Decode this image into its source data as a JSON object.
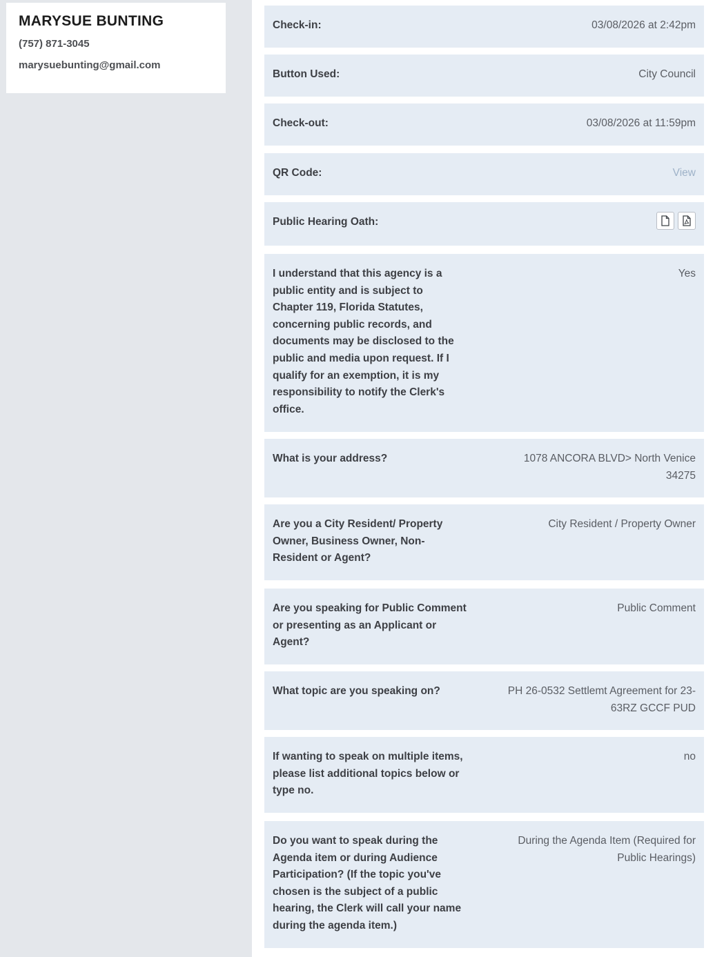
{
  "contact": {
    "name": "MARYSUE BUNTING",
    "phone": "(757) 871-3045",
    "email": "marysuebunting@gmail.com"
  },
  "rows": [
    {
      "label": "Check-in:",
      "value": "03/08/2026 at 2:42pm"
    },
    {
      "label": "Button Used:",
      "value": "City Council"
    },
    {
      "label": "Check-out:",
      "value": "03/08/2026 at 11:59pm"
    },
    {
      "label": "QR Code:",
      "value": "View"
    },
    {
      "label": "Public Hearing Oath:",
      "icons": [
        "document-icon",
        "pdf-icon"
      ]
    },
    {
      "label": "I understand that this agency is a public entity and is subject to Chapter 119, Florida Statutes, concerning public records, and documents may be disclosed to the public and media upon request. If I qualify for an exemption, it is my responsibility to notify the Clerk's office.",
      "value": "Yes"
    },
    {
      "label": "What is your address?",
      "value": "1078 ANCORA BLVD> North Venice 34275"
    },
    {
      "label": "Are you a City Resident/ Property Owner, Business Owner, Non-Resident or Agent?",
      "value": "City Resident / Property Owner"
    },
    {
      "label": "Are you speaking for Public Comment or presenting as an Applicant or Agent?",
      "value": "Public Comment"
    },
    {
      "label": "What topic are you speaking on?",
      "value": "PH 26-0532 Settlemt Agreement for 23-63RZ GCCF PUD"
    },
    {
      "label": "If wanting to speak on multiple items, please list additional topics below or type no.",
      "value": "no"
    },
    {
      "label": "Do you want to speak during the Agenda item or during Audience Participation? (If the topic you've chosen is the subject of a public hearing, the Clerk will call your name during the agenda item.)",
      "value": "During the Agenda Item (Required for Public Hearings)"
    }
  ]
}
